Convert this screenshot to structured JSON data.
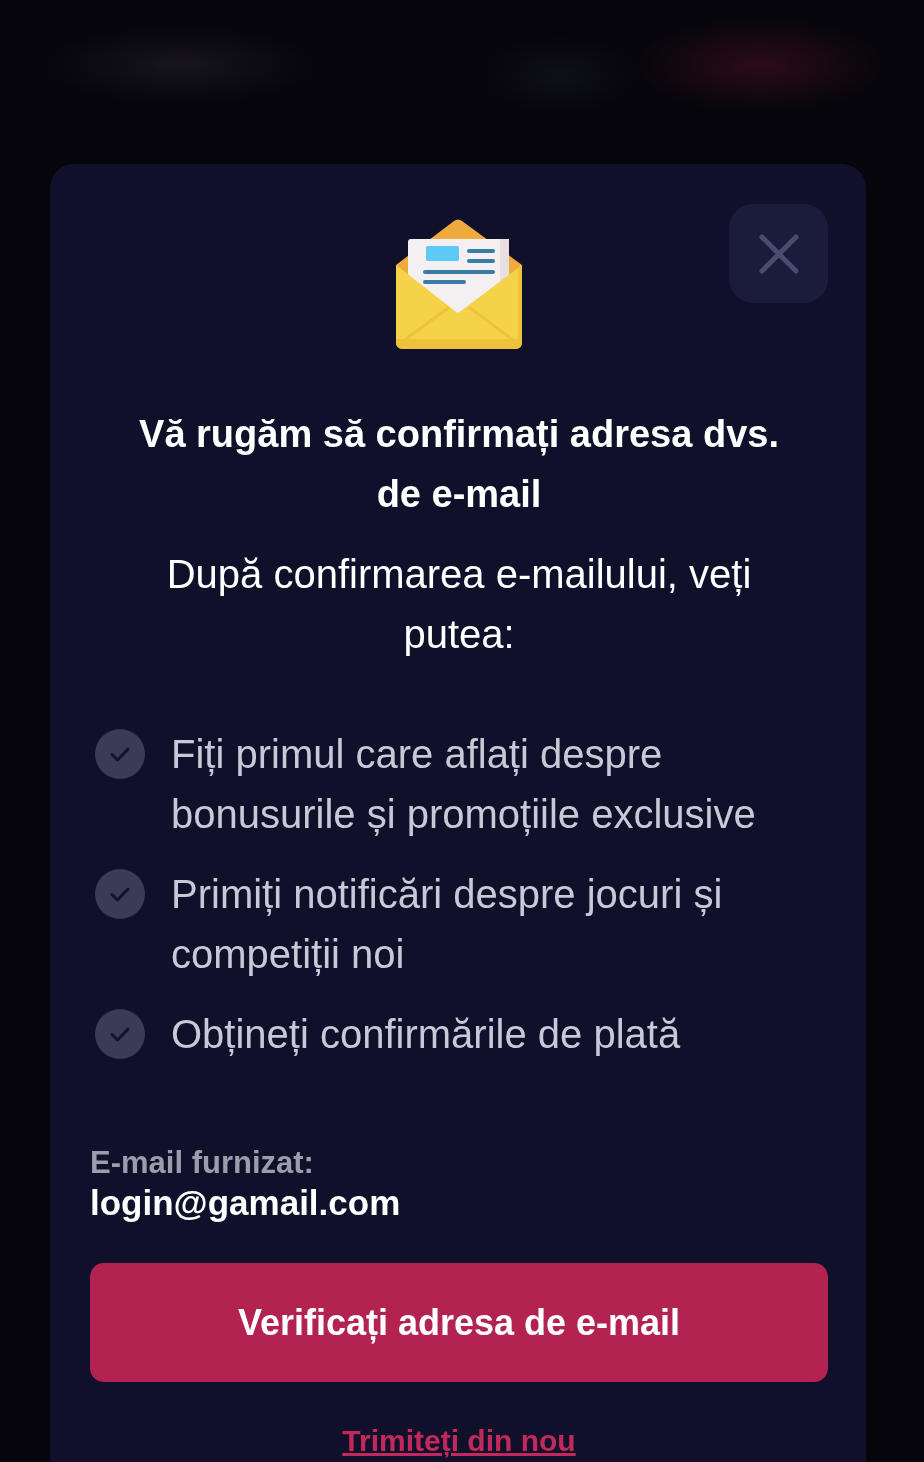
{
  "modal": {
    "title": "Vă rugăm să confirmați adresa dvs. de e-mail",
    "subtitle": "După confirmarea e-mailului, veți putea:",
    "benefits": [
      "Fiți primul care aflați despre bonusurile și promoțiile exclusive",
      "Primiți notificări despre jocuri și competiții noi",
      "Obțineți confirmările de plată"
    ],
    "email_label": "E-mail furnizat:",
    "email_value": "login@gamail.com",
    "primary_button": "Verificați adresa de e-mail",
    "resend_link": "Trimiteți din nou"
  }
}
